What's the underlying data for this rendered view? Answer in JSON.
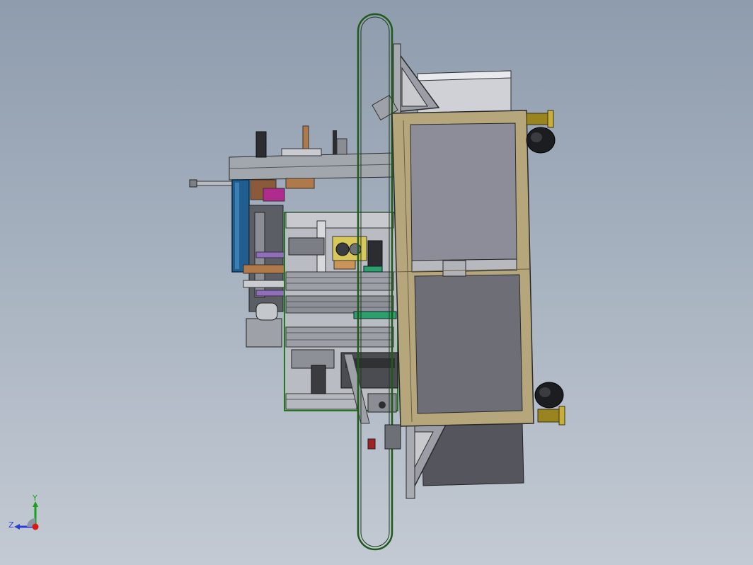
{
  "viewport": {
    "background_top": "#8e9cad",
    "background_bottom": "#c3cad3"
  },
  "model": {
    "frame_color": "#b5a67c",
    "panel_color_upper": "#8c8d98",
    "panel_color_lower": "#6d6e76",
    "belt_color": "#1f5a1a",
    "cylinder_color": "#1f5e8e",
    "accent_purple": "#8f6fb6",
    "accent_magenta": "#b02b8e",
    "brass_color": "#9a8420"
  },
  "triad": {
    "y_label": "Y",
    "z_label": "Z",
    "y_color": "#1aa21a",
    "z_color": "#2a3bd6",
    "x_color": "#d61a1a"
  }
}
